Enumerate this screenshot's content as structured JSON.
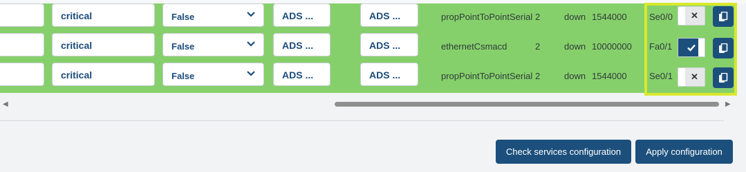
{
  "rows": [
    {
      "severity": "critical",
      "flag": "False",
      "ads1": "ADS ...",
      "ads2": "ADS ...",
      "if_type": "propPointToPointSerial",
      "num": "2",
      "status": "down",
      "speed": "1544000",
      "iface": "Se0/0",
      "enabled": false
    },
    {
      "severity": "critical",
      "flag": "False",
      "ads1": "ADS ...",
      "ads2": "ADS ...",
      "if_type": "ethernetCsmacd",
      "num": "2",
      "status": "down",
      "speed": "10000000",
      "iface": "Fa0/1",
      "enabled": true
    },
    {
      "severity": "critical",
      "flag": "False",
      "ads1": "ADS ...",
      "ads2": "ADS ...",
      "if_type": "propPointToPointSerial",
      "num": "2",
      "status": "down",
      "speed": "1544000",
      "iface": "Se0/1",
      "enabled": false
    }
  ],
  "icons": {
    "toggle_off": "close-icon",
    "toggle_on": "check-icon",
    "copy": "copy-icon",
    "dropdown": "chevron-down-icon"
  },
  "actions": {
    "check_services": "Check services configuration",
    "apply": "Apply configuration"
  },
  "colors": {
    "row_bg": "#86d06b",
    "primary": "#1c4f7c",
    "highlight": "#d9e82e"
  }
}
